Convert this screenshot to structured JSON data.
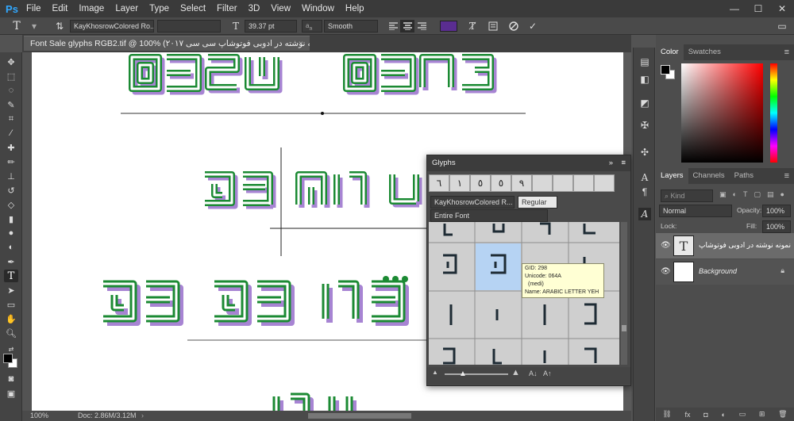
{
  "app": {
    "logo": "Ps"
  },
  "menu": [
    "File",
    "Edit",
    "Image",
    "Layer",
    "Type",
    "Select",
    "Filter",
    "3D",
    "View",
    "Window",
    "Help"
  ],
  "window_controls": {
    "minimize": "—",
    "maximize": "☐",
    "close": "✕"
  },
  "options": {
    "font_family": "KayKhosrowColored Ro...",
    "font_size": "39.37 pt",
    "antialias": "Smooth",
    "text_color": "#5a2d91"
  },
  "document": {
    "tab_title": "Font Sale glyphs RGB2.tif @ 100% (نمونه نوشته در ادوبی فوتوشاپ سی سی ۲۰۱۷ , RGB/8) *",
    "close": "×"
  },
  "status": {
    "zoom": "100%",
    "doc_size": "Doc: 2.86M/3.12M"
  },
  "glyphs_panel": {
    "title": "Glyphs",
    "collapse": "»",
    "recent": [
      "٦",
      "١",
      "٥",
      "٥",
      "٩"
    ],
    "font": "KayKhosrowColored R...",
    "style": "Regular",
    "show": "Entire Font",
    "tooltip": {
      "gid": "GID: 298",
      "unicode": "Unicode: 064A",
      "form": "(medi)",
      "name": "Name: ARABIC LETTER YEH"
    }
  },
  "color_panel": {
    "tab_color": "Color",
    "tab_swatches": "Swatches",
    "fg": "#000000",
    "bg": "#ffffff"
  },
  "layers_panel": {
    "tabs": [
      "Layers",
      "Channels",
      "Paths"
    ],
    "kind": "Kind",
    "blend": "Normal",
    "opacity_label": "Opacity:",
    "opacity": "100%",
    "fill_label": "Fill:",
    "fill": "100%",
    "lock_label": "Lock:",
    "layers": [
      {
        "name": "نمونه نوشته در ادوبی فوتوشاپ",
        "type": "text",
        "selected": true
      },
      {
        "name": "Background",
        "type": "image",
        "selected": false
      }
    ]
  },
  "colors": {
    "stroke_green": "#1f9a3b",
    "shadow_purple": "#8a63c6",
    "panel": "#4d4d4d"
  }
}
